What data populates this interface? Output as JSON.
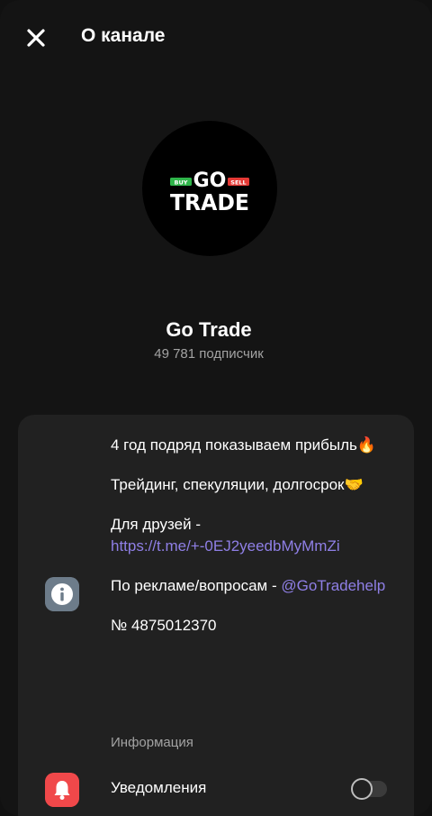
{
  "header": {
    "title": "О канале",
    "close_icon": "close-icon"
  },
  "channel": {
    "name": "Go Trade",
    "subscribers": "49 781 подписчик",
    "logo": {
      "text_top": "GO",
      "text_bottom": "TRADE",
      "buy": "BUY",
      "sell": "SELL",
      "colors": {
        "buy": "#2fb54a",
        "sell": "#e53935",
        "background": "#000000"
      }
    }
  },
  "about": {
    "line1": "4 год подряд показываем прибыль🔥",
    "line2": "Трейдинг, спекуляции, долгосрок🤝",
    "friends_prefix": "Для друзей - ",
    "friends_link": "https://t.me/+-0EJ2yeedbMyMmZi",
    "ads_prefix": "По рекламе/вопросам - ",
    "ads_handle": "@GoTradehelp",
    "number": "№ 4875012370",
    "label": "Информация",
    "icon": "info-icon"
  },
  "notifications": {
    "label": "Уведомления",
    "icon": "bell-icon",
    "enabled": false
  },
  "colors": {
    "background": "#141414",
    "card": "#212121",
    "link": "#8f7fe6",
    "secondary_text": "#a3a3a3",
    "info_icon_bg": "#6d7c8a",
    "bell_icon_bg": "#f0484a"
  }
}
